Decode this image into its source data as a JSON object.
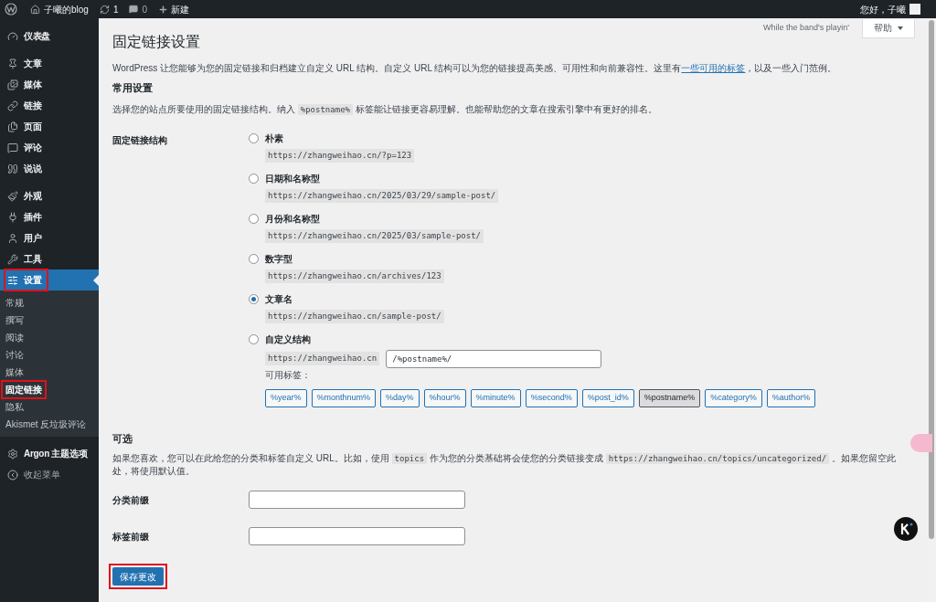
{
  "admin_bar": {
    "site": "子曦的blog",
    "updates": "1",
    "comments": "0",
    "new": "新建",
    "greeting": "您好，子曦"
  },
  "sidebar": {
    "items": [
      {
        "label": "仪表盘",
        "selected": false,
        "highlighted": false
      },
      {
        "label": "文章",
        "selected": false,
        "highlighted": false
      },
      {
        "label": "媒体",
        "selected": false,
        "highlighted": false
      },
      {
        "label": "链接",
        "selected": false,
        "highlighted": false
      },
      {
        "label": "页面",
        "selected": false,
        "highlighted": false
      },
      {
        "label": "评论",
        "selected": false,
        "highlighted": false
      },
      {
        "label": "说说",
        "selected": false,
        "highlighted": false
      },
      {
        "label": "外观",
        "selected": false,
        "highlighted": false
      },
      {
        "label": "插件",
        "selected": false,
        "highlighted": false
      },
      {
        "label": "用户",
        "selected": false,
        "highlighted": false
      },
      {
        "label": "工具",
        "selected": false,
        "highlighted": false
      },
      {
        "label": "设置",
        "selected": true,
        "highlighted": true,
        "children": [
          {
            "label": "常规",
            "selected": false,
            "highlighted": false
          },
          {
            "label": "撰写",
            "selected": false,
            "highlighted": false
          },
          {
            "label": "阅读",
            "selected": false,
            "highlighted": false
          },
          {
            "label": "讨论",
            "selected": false,
            "highlighted": false
          },
          {
            "label": "媒体",
            "selected": false,
            "highlighted": false
          },
          {
            "label": "固定链接",
            "selected": true,
            "highlighted": true
          },
          {
            "label": "隐私",
            "selected": false,
            "highlighted": false
          },
          {
            "label": "Akismet 反垃圾评论",
            "selected": false,
            "highlighted": false
          }
        ]
      },
      {
        "label": "Argon 主题选项",
        "selected": false,
        "highlighted": false
      }
    ],
    "collapse": "收起菜单"
  },
  "header": {
    "lyric": "While the band's playin'",
    "help": "帮助"
  },
  "title": "固定链接设置",
  "intro": [
    {
      "kind": "text",
      "text": "WordPress 让您能够为您的固定链接和归档建立自定义 URL 结构。自定义 URL 结构可以为您的链接提高美感、可用性和向前兼容性。这里有"
    },
    {
      "kind": "link",
      "text": "一些可用的标签"
    },
    {
      "kind": "text",
      "text": "，以及一些入门范例。"
    }
  ],
  "common": {
    "heading": "常用设置",
    "description": [
      {
        "kind": "text",
        "text": "选择您的站点所要使用的固定链接结构。纳入 "
      },
      {
        "kind": "code",
        "text": "%postname%"
      },
      {
        "kind": "text",
        "text": " 标签能让链接更容易理解。也能帮助您的文章在搜索引擎中有更好的排名。"
      }
    ],
    "structure_label": "固定链接结构",
    "options": [
      {
        "label": "朴素",
        "example": "https://zhangweihao.cn/?p=123",
        "selected": false
      },
      {
        "label": "日期和名称型",
        "example": "https://zhangweihao.cn/2025/03/29/sample-post/",
        "selected": false
      },
      {
        "label": "月份和名称型",
        "example": "https://zhangweihao.cn/2025/03/sample-post/",
        "selected": false
      },
      {
        "label": "数字型",
        "example": "https://zhangweihao.cn/archives/123",
        "selected": false
      },
      {
        "label": "文章名",
        "example": "https://zhangweihao.cn/sample-post/",
        "selected": true
      },
      {
        "label": "自定义结构",
        "example": "https://zhangweihao.cn",
        "value": "/%postname%/",
        "selected": false
      }
    ],
    "tags_label": "可用标签：",
    "tags": [
      {
        "label": "%year%",
        "selected": false
      },
      {
        "label": "%monthnum%",
        "selected": false
      },
      {
        "label": "%day%",
        "selected": false
      },
      {
        "label": "%hour%",
        "selected": false
      },
      {
        "label": "%minute%",
        "selected": false
      },
      {
        "label": "%second%",
        "selected": false
      },
      {
        "label": "%post_id%",
        "selected": false
      },
      {
        "label": "%postname%",
        "selected": true
      },
      {
        "label": "%category%",
        "selected": false
      },
      {
        "label": "%author%",
        "selected": false
      }
    ]
  },
  "optional": {
    "heading": "可选",
    "description": [
      {
        "kind": "text",
        "text": "如果您喜欢，您可以在此给您的分类和标签自定义 URL。比如，使用 "
      },
      {
        "kind": "code",
        "text": "topics"
      },
      {
        "kind": "text",
        "text": " 作为您的分类基础将会使您的分类链接变成 "
      },
      {
        "kind": "code",
        "text": "https://zhangweihao.cn/topics/uncategorized/"
      },
      {
        "kind": "text",
        "text": " 。如果您留空此处，将使用默认值。"
      }
    ],
    "fields": [
      {
        "label": "分类前缀"
      },
      {
        "label": "标签前缀"
      }
    ]
  },
  "save": {
    "label": "保存更改",
    "highlighted": true
  }
}
